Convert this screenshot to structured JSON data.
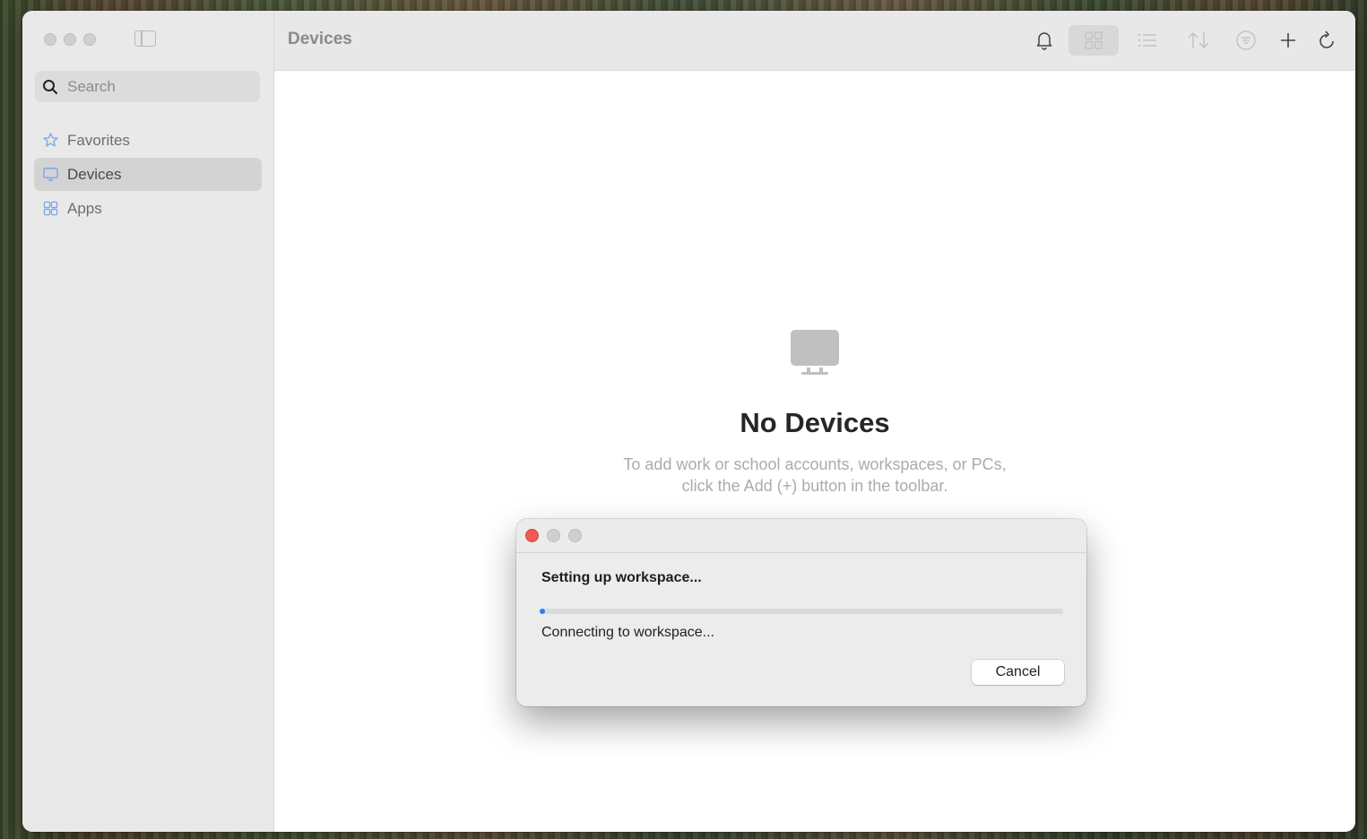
{
  "window": {
    "title": "Devices"
  },
  "sidebar": {
    "search": {
      "placeholder": "Search",
      "value": ""
    },
    "items": [
      {
        "label": "Favorites",
        "icon": "star-icon",
        "active": false
      },
      {
        "label": "Devices",
        "icon": "monitor-icon",
        "active": true
      },
      {
        "label": "Apps",
        "icon": "apps-grid-icon",
        "active": false
      }
    ]
  },
  "toolbar": {
    "icons": [
      "bell-icon",
      "grid-view-icon",
      "list-view-icon",
      "sort-icon",
      "filter-icon",
      "add-icon",
      "refresh-icon"
    ]
  },
  "empty_state": {
    "icon": "monitor-icon",
    "title": "No Devices",
    "line1": "To add work or school accounts, workspaces, or PCs,",
    "line2": "click the Add (+) button in the toolbar."
  },
  "dialog": {
    "heading": "Setting up workspace...",
    "status": "Connecting to workspace...",
    "progress": 0.01,
    "cancel_label": "Cancel"
  },
  "colors": {
    "accent": "#2f7df6",
    "close": "#ee5b53",
    "sidebar_bg": "#e9e9e9",
    "toolbar_bg": "#e8e8e8"
  }
}
